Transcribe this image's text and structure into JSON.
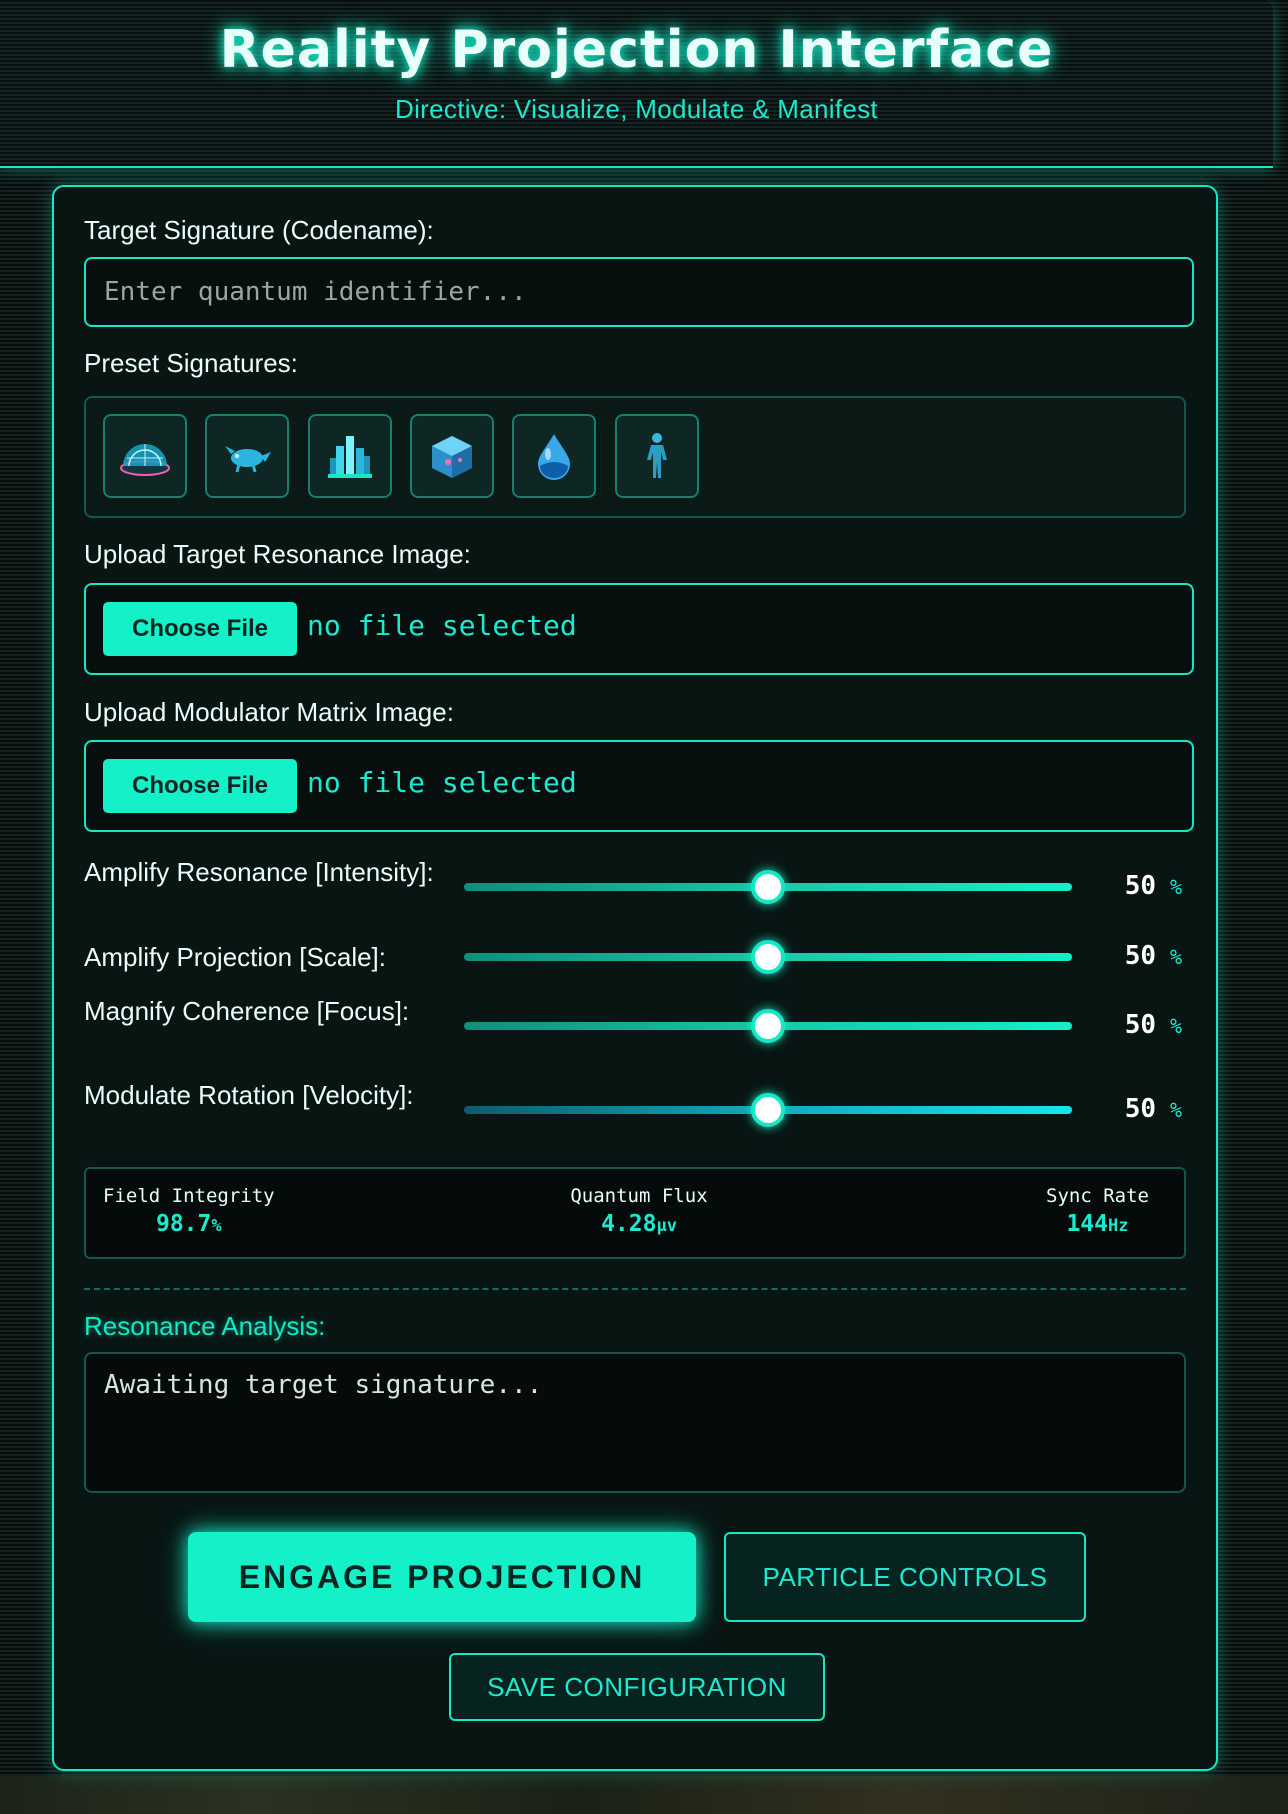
{
  "header": {
    "title": "Reality Projection Interface",
    "subtitle": "Directive: Visualize, Modulate & Manifest"
  },
  "target": {
    "label": "Target Signature (Codename):",
    "placeholder": "Enter quantum identifier...",
    "value": ""
  },
  "presets": {
    "label": "Preset Signatures:",
    "items": [
      {
        "icon": "dome-icon"
      },
      {
        "icon": "creature-icon"
      },
      {
        "icon": "crystal-city-icon"
      },
      {
        "icon": "cube-icon"
      },
      {
        "icon": "water-drop-icon"
      },
      {
        "icon": "humanoid-figure-icon"
      }
    ]
  },
  "upload_resonance": {
    "label": "Upload Target Resonance Image:",
    "button": "Choose File",
    "status": "no file selected"
  },
  "upload_modulator": {
    "label": "Upload Modulator Matrix Image:",
    "button": "Choose File",
    "status": "no file selected"
  },
  "sliders": [
    {
      "label": "Amplify Resonance [Intensity]:",
      "value": "50",
      "unit": "%",
      "fraction": 0.5
    },
    {
      "label": "Amplify Projection [Scale]:",
      "value": "50",
      "unit": "%",
      "fraction": 0.5
    },
    {
      "label": "Magnify Coherence [Focus]:",
      "value": "50",
      "unit": "%",
      "fraction": 0.5
    },
    {
      "label": "Modulate Rotation [Velocity]:",
      "value": "50",
      "unit": "%",
      "fraction": 0.5
    }
  ],
  "stats": [
    {
      "label": "Field Integrity",
      "value": "98.7",
      "unit": "%"
    },
    {
      "label": "Quantum Flux",
      "value": "4.28",
      "unit": "μv"
    },
    {
      "label": "Sync Rate",
      "value": "144",
      "unit": "Hz"
    }
  ],
  "analysis": {
    "label": "Resonance Analysis:",
    "text": "Awaiting target signature..."
  },
  "actions": {
    "engage": "ENGAGE PROJECTION",
    "particles": "PARTICLE CONTROLS",
    "save": "SAVE CONFIGURATION"
  },
  "colors": {
    "accent": "#14e8c4",
    "background": "#081513",
    "text": "#e8fff8"
  }
}
